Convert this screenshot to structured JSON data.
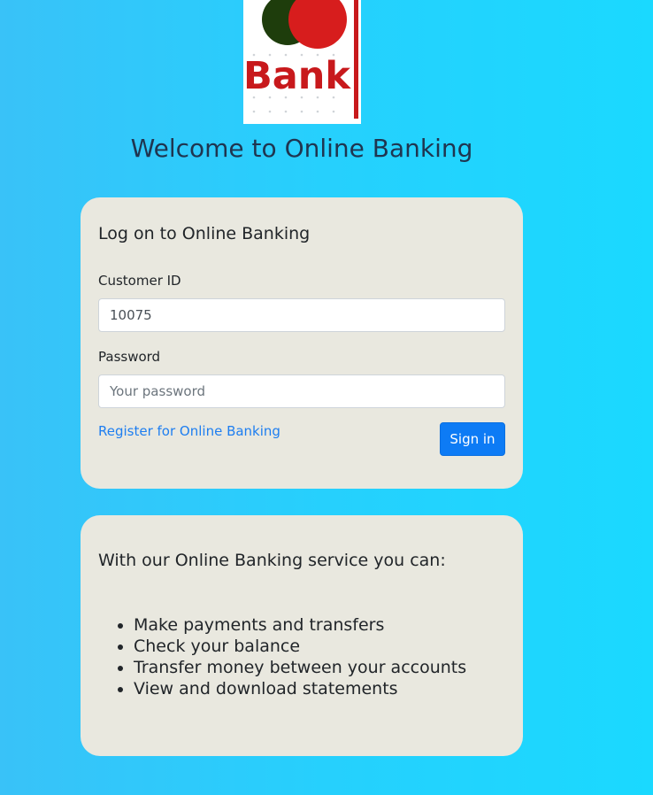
{
  "logo": {
    "text": "Bank",
    "colors": {
      "circle_dark": "#1e3d0c",
      "circle_red": "#d71d1d",
      "text_red": "#c8191c"
    }
  },
  "page": {
    "welcome_title": "Welcome to Online Banking"
  },
  "login": {
    "title": "Log on to Online Banking",
    "customer_id_label": "Customer ID",
    "customer_id_value": "10075",
    "password_label": "Password",
    "password_placeholder": "Your password",
    "register_link": "Register for Online Banking",
    "signin_label": "Sign in"
  },
  "info": {
    "title": "With our Online Banking service you can:",
    "features": [
      "Make payments and transfers",
      "Check your balance",
      "Transfer money between your accounts",
      "View and download statements"
    ]
  },
  "colors": {
    "background_from": "#39c2f8",
    "background_to": "#1ad9ff",
    "card_bg": "#e9e8df",
    "link": "#1e7ef0",
    "button_primary": "#0d7bf5",
    "heading": "#1f3550"
  }
}
